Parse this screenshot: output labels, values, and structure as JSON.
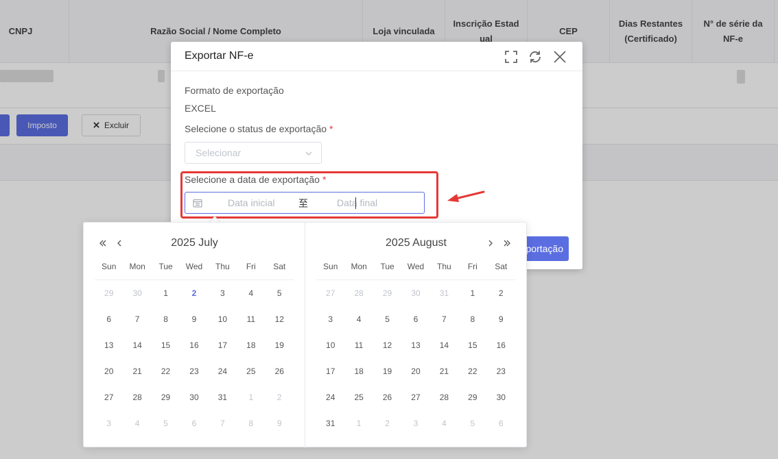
{
  "table": {
    "headers": [
      {
        "text": "CNPJ"
      },
      {
        "text": "Razão Social / Nome Completo"
      },
      {
        "text": "Loja vinculada"
      },
      {
        "text": "Inscrição Estad ual"
      },
      {
        "text": "CEP"
      },
      {
        "text": "Dias Restantes (Certificado)"
      },
      {
        "text": "N° de série da NF-e"
      }
    ]
  },
  "actions": {
    "imposto": "Imposto",
    "excluir": "Excluir"
  },
  "modal": {
    "title": "Exportar NF-e",
    "format_label": "Formato de exportação",
    "format_value": "EXCEL",
    "status_label": "Selecione o status de exportação",
    "status_placeholder": "Selecionar",
    "date_label": "Selecione a data de exportação",
    "required_mark": "*",
    "start_placeholder": "Data inicial",
    "range_separator": "至",
    "end_placeholder": "Data final",
    "export_button": "Exportação"
  },
  "datepicker": {
    "weekdays": [
      "Sun",
      "Mon",
      "Tue",
      "Wed",
      "Thu",
      "Fri",
      "Sat"
    ],
    "left": {
      "title": "2025 July",
      "weeks": [
        [
          {
            "d": "29",
            "m": 1
          },
          {
            "d": "30",
            "m": 1
          },
          {
            "d": "1"
          },
          {
            "d": "2",
            "t": 1
          },
          {
            "d": "3"
          },
          {
            "d": "4"
          },
          {
            "d": "5"
          }
        ],
        [
          {
            "d": "6"
          },
          {
            "d": "7"
          },
          {
            "d": "8"
          },
          {
            "d": "9"
          },
          {
            "d": "10"
          },
          {
            "d": "11"
          },
          {
            "d": "12"
          }
        ],
        [
          {
            "d": "13"
          },
          {
            "d": "14"
          },
          {
            "d": "15"
          },
          {
            "d": "16"
          },
          {
            "d": "17"
          },
          {
            "d": "18"
          },
          {
            "d": "19"
          }
        ],
        [
          {
            "d": "20"
          },
          {
            "d": "21"
          },
          {
            "d": "22"
          },
          {
            "d": "23"
          },
          {
            "d": "24"
          },
          {
            "d": "25"
          },
          {
            "d": "26"
          }
        ],
        [
          {
            "d": "27"
          },
          {
            "d": "28"
          },
          {
            "d": "29"
          },
          {
            "d": "30"
          },
          {
            "d": "31"
          },
          {
            "d": "1",
            "m": 1
          },
          {
            "d": "2",
            "m": 1
          }
        ],
        [
          {
            "d": "3",
            "m": 1
          },
          {
            "d": "4",
            "m": 1
          },
          {
            "d": "5",
            "m": 1
          },
          {
            "d": "6",
            "m": 1
          },
          {
            "d": "7",
            "m": 1
          },
          {
            "d": "8",
            "m": 1
          },
          {
            "d": "9",
            "m": 1
          }
        ]
      ]
    },
    "right": {
      "title": "2025 August",
      "weeks": [
        [
          {
            "d": "27",
            "m": 1
          },
          {
            "d": "28",
            "m": 1
          },
          {
            "d": "29",
            "m": 1
          },
          {
            "d": "30",
            "m": 1
          },
          {
            "d": "31",
            "m": 1
          },
          {
            "d": "1"
          },
          {
            "d": "2"
          }
        ],
        [
          {
            "d": "3"
          },
          {
            "d": "4"
          },
          {
            "d": "5"
          },
          {
            "d": "6"
          },
          {
            "d": "7"
          },
          {
            "d": "8"
          },
          {
            "d": "9"
          }
        ],
        [
          {
            "d": "10"
          },
          {
            "d": "11"
          },
          {
            "d": "12"
          },
          {
            "d": "13"
          },
          {
            "d": "14"
          },
          {
            "d": "15"
          },
          {
            "d": "16"
          }
        ],
        [
          {
            "d": "17"
          },
          {
            "d": "18"
          },
          {
            "d": "19"
          },
          {
            "d": "20"
          },
          {
            "d": "21"
          },
          {
            "d": "22"
          },
          {
            "d": "23"
          }
        ],
        [
          {
            "d": "24"
          },
          {
            "d": "25"
          },
          {
            "d": "26"
          },
          {
            "d": "27"
          },
          {
            "d": "28"
          },
          {
            "d": "29"
          },
          {
            "d": "30"
          }
        ],
        [
          {
            "d": "31"
          },
          {
            "d": "1",
            "m": 1
          },
          {
            "d": "2",
            "m": 1
          },
          {
            "d": "3",
            "m": 1
          },
          {
            "d": "4",
            "m": 1
          },
          {
            "d": "5",
            "m": 1
          },
          {
            "d": "6",
            "m": 1
          }
        ]
      ]
    }
  },
  "colors": {
    "primary": "#5b6ee1",
    "required": "#e53935",
    "annotation": "#e53935",
    "overlay": "rgba(0,0,0,0.2)"
  }
}
